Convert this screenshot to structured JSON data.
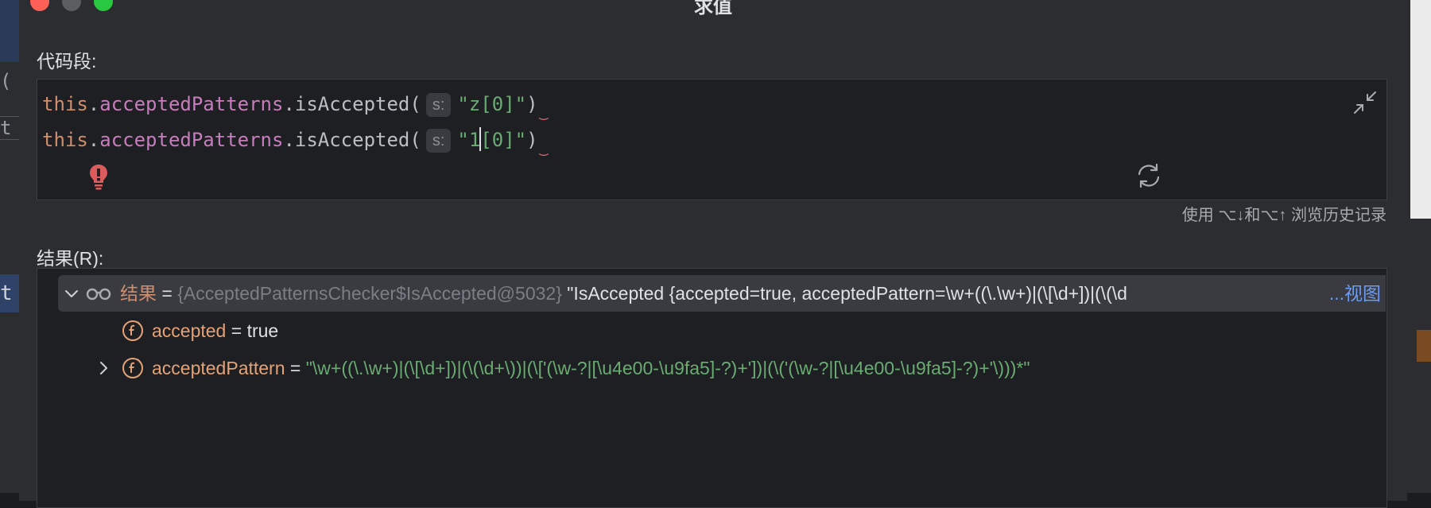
{
  "window": {
    "title": "求值"
  },
  "background": {
    "left_fragments": [
      "(",
      "t",
      "t"
    ]
  },
  "code_section": {
    "label": "代码段:",
    "lines": [
      {
        "keyword": "this",
        "dot1": ".",
        "field": "acceptedPatterns",
        "method": ".isAccepted(",
        "param_hint": "s:",
        "arg_before_caret": "\"z[0]\"",
        "arg_after_caret": "",
        "close": ")"
      },
      {
        "keyword": "this",
        "dot1": ".",
        "field": "acceptedPatterns",
        "method": ".isAccepted(",
        "param_hint": "s:",
        "arg_before_caret": "\"1",
        "arg_after_caret": "[0]\"",
        "close": ")"
      }
    ],
    "history_hint": "使用 ⌥↓和⌥↑ 浏览历史记录"
  },
  "results_section": {
    "label": "结果(R):",
    "root": {
      "name": "结果",
      "equals": " = ",
      "class_ref": "{AcceptedPatternsChecker$IsAccepted@5032}",
      "value": " \"IsAccepted {accepted=true, acceptedPattern=\\w+((\\.\\w+)|(\\[\\d+])|(\\(\\d",
      "view_link": "...视图"
    },
    "children": [
      {
        "name": "accepted",
        "equals": " = ",
        "value": "true"
      },
      {
        "name": "acceptedPattern",
        "equals": " = ",
        "value": "\"\\w+((\\.\\w+)|(\\[\\d+])|(\\(\\d+\\))|(\\['(\\w-?|[\\u4e00-\\u9fa5]-?)+'])|(\\('(\\w-?|[\\u4e00-\\u9fa5]-?)+'\\)))*\""
      }
    ]
  },
  "colors": {
    "keyword": "#cf8e6d",
    "field": "#c77dbb",
    "string": "#6aab73",
    "link": "#6b9bf2",
    "error": "#e06c75"
  }
}
